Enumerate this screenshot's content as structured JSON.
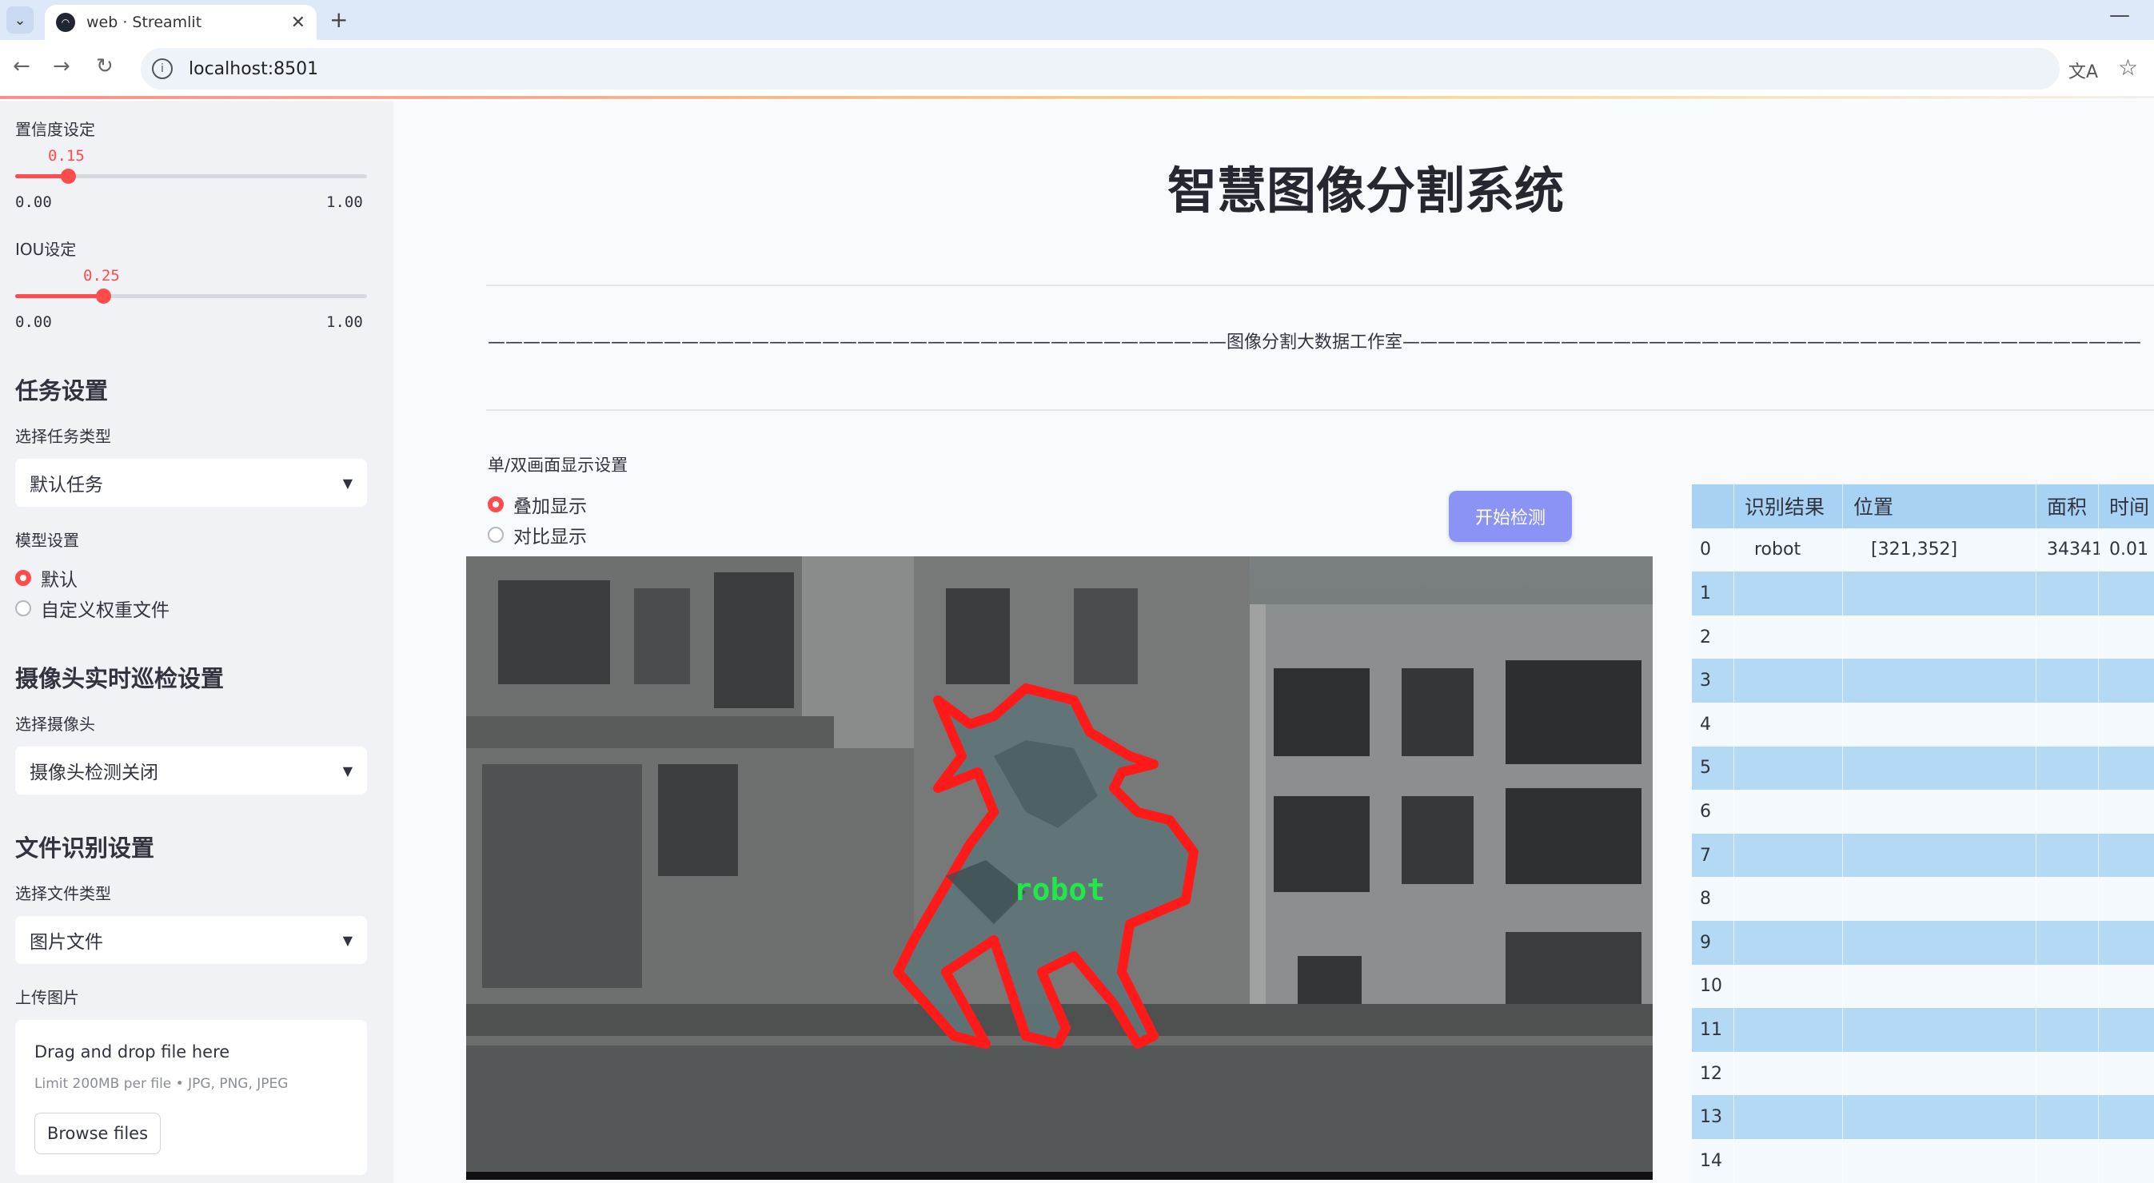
{
  "browser": {
    "tab_title": "web · Streamlit",
    "url": "localhost:8501"
  },
  "sidebar": {
    "confidence": {
      "label": "置信度设定",
      "value": "0.15",
      "value_num": 0.15,
      "min": "0.00",
      "max": "1.00"
    },
    "iou": {
      "label": "IOU设定",
      "value": "0.25",
      "value_num": 0.25,
      "min": "0.00",
      "max": "1.00"
    },
    "task": {
      "heading": "任务设置",
      "select_label": "选择任务类型",
      "selected": "默认任务"
    },
    "model": {
      "label": "模型设置",
      "options": [
        "默认",
        "自定义权重文件"
      ],
      "selected_index": 0
    },
    "camera": {
      "heading": "摄像头实时巡检设置",
      "select_label": "选择摄像头",
      "selected": "摄像头检测关闭"
    },
    "file": {
      "heading": "文件识别设置",
      "select_label": "选择文件类型",
      "selected": "图片文件"
    },
    "upload": {
      "label": "上传图片",
      "drop_text": "Drag and drop file here",
      "limit_text": "Limit 200MB per file • JPG, PNG, JPEG",
      "browse_label": "Browse files"
    }
  },
  "main": {
    "title": "智慧图像分割系统",
    "studio_line": "——————————————————————————————————————————图像分割大数据工作室——————————————————————————————————————————",
    "display_label": "单/双画面显示设置",
    "display_options": [
      "叠加显示",
      "对比显示"
    ],
    "display_selected_index": 0,
    "start_button": "开始检测",
    "detection_label": "robot"
  },
  "table": {
    "columns": [
      "",
      "识别结果",
      "位置",
      "面积",
      "时间"
    ],
    "rows": [
      [
        "0",
        "robot",
        "[321,352]",
        "34341",
        "0.01"
      ],
      [
        "1",
        "",
        "",
        "",
        ""
      ],
      [
        "2",
        "",
        "",
        "",
        ""
      ],
      [
        "3",
        "",
        "",
        "",
        ""
      ],
      [
        "4",
        "",
        "",
        "",
        ""
      ],
      [
        "5",
        "",
        "",
        "",
        ""
      ],
      [
        "6",
        "",
        "",
        "",
        ""
      ],
      [
        "7",
        "",
        "",
        "",
        ""
      ],
      [
        "8",
        "",
        "",
        "",
        ""
      ],
      [
        "9",
        "",
        "",
        "",
        ""
      ],
      [
        "10",
        "",
        "",
        "",
        ""
      ],
      [
        "11",
        "",
        "",
        "",
        ""
      ],
      [
        "12",
        "",
        "",
        "",
        ""
      ],
      [
        "13",
        "",
        "",
        "",
        ""
      ],
      [
        "14",
        "",
        "",
        "",
        ""
      ]
    ]
  },
  "colors": {
    "accent": "#ff4b4b",
    "sidebar_bg": "#f0f2f6",
    "button": "#8b93f5",
    "table_header": "#a7d2f3",
    "mask_outline": "#ff1a1a",
    "label_text": "#22e64a"
  }
}
